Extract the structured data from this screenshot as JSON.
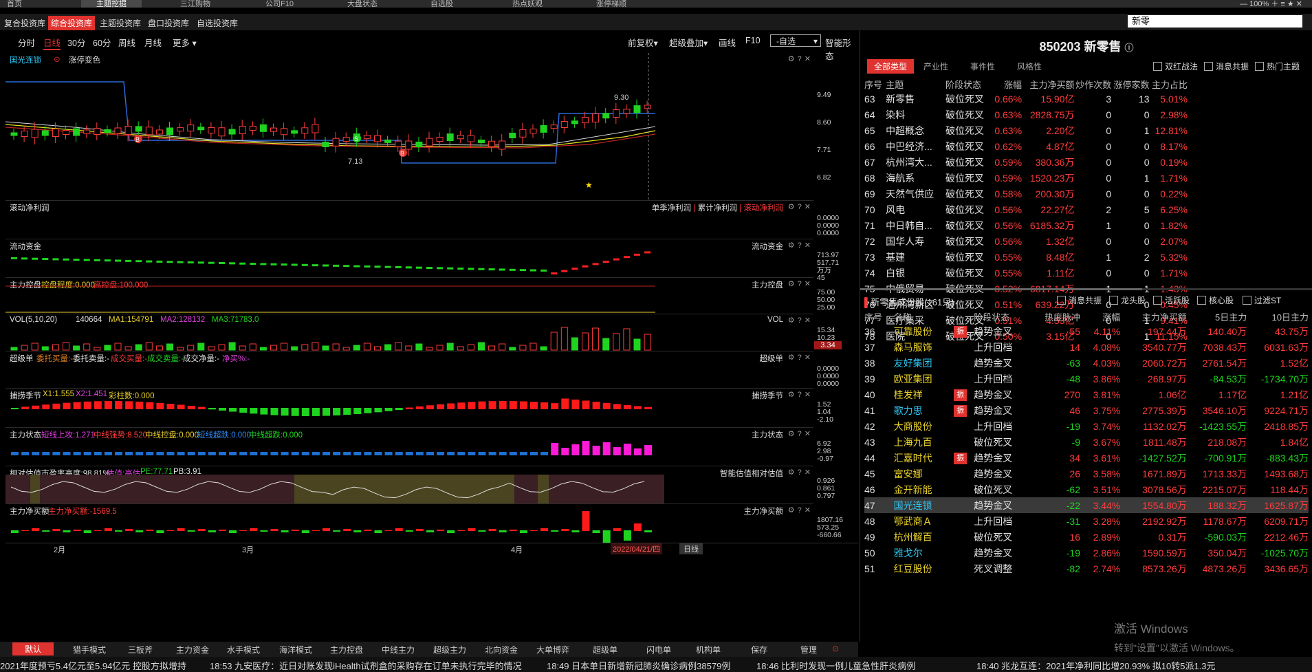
{
  "topnav": {
    "items": [
      "首页",
      "主题挖掘",
      "三江购物",
      "公司F10",
      "大盘状态",
      "自选股",
      "热点妖观",
      "涨停梯顺"
    ],
    "active_index": 1,
    "zoom": "100%"
  },
  "libraries": {
    "items": [
      "复合投资库",
      "综合投资库",
      "主题投资库",
      "盘口投资库",
      "自选投资库"
    ],
    "active_index": 1
  },
  "search": {
    "value": "新零"
  },
  "chart_toolbar": {
    "periods": [
      "分时",
      "日线",
      "30分",
      "60分",
      "周线",
      "月线",
      "更多 ▾"
    ],
    "active_index": 1,
    "right": [
      "前复权▾",
      "超级叠加▾",
      "画线",
      "F10"
    ],
    "self_select": "-自选",
    "smart": "智能形态"
  },
  "panels": {
    "main": {
      "name": "国光连锁",
      "limit": "涨停变色",
      "price_high_label": "9.30",
      "price_low_label": "7.13",
      "axis": [
        "9.49",
        "8.60",
        "7.71",
        "6.82"
      ]
    },
    "profit": {
      "title": "滚动净利润",
      "r1": "单季净利润",
      "r2": "累计净利润",
      "r3": "滚动净利润",
      "axis": [
        "0.0000",
        "0.0000",
        "0.0000"
      ]
    },
    "flow": {
      "title": "流动资金",
      "r": "流动资金",
      "axis": [
        "713.97",
        "517.71",
        "万万45"
      ]
    },
    "control": {
      "title": "主力控盘",
      "a": "控盘程度:0.000",
      "b": "高控盘:100.000",
      "r": "主力控盘",
      "axis": [
        "75.00",
        "50.00",
        "25.00"
      ]
    },
    "vol": {
      "title": "VOL(5,10,20)",
      "v": "140664",
      "ma1": "MA1:154791",
      "ma2": "MA2:128132",
      "ma3": "MA3:71783.0",
      "r": "VOL",
      "axis": [
        "15.34",
        "10.23"
      ],
      "tag": "3.34"
    },
    "super": {
      "title": "超级单",
      "a": "委托买量:-",
      "b": "委托卖量:-",
      "c": "成交买量:-",
      "d": "成交卖量:-",
      "e": "成交净量:-",
      "f": "净买%:-",
      "r": "超级单",
      "axis": [
        "0.0000",
        "0.0000",
        "0.0000"
      ]
    },
    "catch": {
      "title": "捕捞季节",
      "a": "X1:1.555",
      "b": "X2:1.451",
      "c": "彩柱数:0.000",
      "r": "捕捞季节",
      "axis": [
        "1.52",
        "1.04",
        "-2.10"
      ]
    },
    "state": {
      "title": "主力状态",
      "a": "短线上攻:1.271",
      "b": "中线强势:8.520",
      "c": "中线控盘:0.000",
      "d": "短线超跌:0.000",
      "e": "中线超跌:0.000",
      "r": "主力状态",
      "axis": [
        "6.92",
        "2.98",
        "-0.97"
      ]
    },
    "val": {
      "title": "相对估值",
      "a": "市盈率高度:98.81%",
      "b": "估值:高估",
      "c": "PE:77.71",
      "d": "PB:3.91",
      "r": "智能估值相对估值",
      "axis": [
        "0.926",
        "0.861",
        "0.797"
      ]
    },
    "net": {
      "title": "主力净买额",
      "a": "主力净买额:-1569.5",
      "r": "主力净买额",
      "axis": [
        "1807.16",
        "573.25",
        "-660.66"
      ]
    }
  },
  "xaxis": {
    "labels": [
      "2月",
      "3月",
      "4月"
    ],
    "date": "2022/04/21/四",
    "period": "日线"
  },
  "right": {
    "title": "850203 新零售",
    "tabs": [
      "全部类型",
      "产业性",
      "事件性",
      "风格性"
    ],
    "checks": [
      "双红战法",
      "消息共振",
      "热门主题"
    ],
    "headers": [
      "序号",
      "主题",
      "阶段状态",
      "涨幅",
      "主力净买额",
      "炒作次数",
      "涨停家数",
      "主力占比"
    ],
    "rows": [
      [
        "63",
        "新零售",
        "破位死叉",
        "0.66%",
        "15.90亿",
        "3",
        "13",
        "5.01%"
      ],
      [
        "64",
        "染料",
        "破位死叉",
        "0.63%",
        "2828.75万",
        "0",
        "0",
        "2.98%"
      ],
      [
        "65",
        "中超概念",
        "破位死叉",
        "0.63%",
        "2.20亿",
        "0",
        "1",
        "12.81%"
      ],
      [
        "66",
        "中巴经济...",
        "破位死叉",
        "0.62%",
        "4.87亿",
        "0",
        "0",
        "8.17%"
      ],
      [
        "67",
        "杭州湾大...",
        "破位死叉",
        "0.59%",
        "380.36万",
        "0",
        "0",
        "0.19%"
      ],
      [
        "68",
        "海航系",
        "破位死叉",
        "0.59%",
        "1520.23万",
        "0",
        "1",
        "1.71%"
      ],
      [
        "69",
        "天然气供应",
        "破位死叉",
        "0.58%",
        "200.30万",
        "0",
        "0",
        "0.22%"
      ],
      [
        "70",
        "风电",
        "破位死叉",
        "0.56%",
        "22.27亿",
        "2",
        "5",
        "6.25%"
      ],
      [
        "71",
        "中日韩自...",
        "破位死叉",
        "0.56%",
        "6185.32万",
        "1",
        "0",
        "1.82%"
      ],
      [
        "72",
        "国华人寿",
        "破位死叉",
        "0.56%",
        "1.32亿",
        "0",
        "0",
        "2.07%"
      ],
      [
        "73",
        "基建",
        "破位死叉",
        "0.55%",
        "8.48亿",
        "1",
        "2",
        "5.32%"
      ],
      [
        "74",
        "白银",
        "破位死叉",
        "0.55%",
        "1.11亿",
        "0",
        "0",
        "1.71%"
      ],
      [
        "75",
        "中俄贸易",
        "破位死叉",
        "0.52%",
        "6817.14万",
        "1",
        "1",
        "1.43%"
      ],
      [
        "76",
        "通州湾新区",
        "破位死叉",
        "0.51%",
        "639.22万",
        "0",
        "0",
        "0.45%"
      ],
      [
        "77",
        "医疗集采",
        "破位死叉",
        "0.51%",
        "4.53亿",
        "0",
        "1",
        "9.41%"
      ],
      [
        "78",
        "医院",
        "破位死叉",
        "0.50%",
        "3.15亿",
        "0",
        "1",
        "11.15%"
      ]
    ],
    "comp_title": "新零售成份股(161只)",
    "comp_checks": [
      "消息共振",
      "龙头股",
      "活跃股",
      "核心股",
      "过滤ST"
    ],
    "comp_headers": [
      "序号",
      "名称",
      "",
      "阶段状态",
      "热度脉冲",
      "涨幅",
      "主力净买额",
      "5日主力",
      "10日主力"
    ],
    "comp_rows": [
      [
        "36",
        "可靠股份",
        "振",
        "趋势金叉",
        "55",
        "4.11%",
        "197.44万",
        "140.40万",
        "43.75万"
      ],
      [
        "37",
        "森马服饰",
        "",
        "上升回档",
        "14",
        "4.08%",
        "3540.77万",
        "7038.43万",
        "6031.63万"
      ],
      [
        "38",
        "友好集团",
        "",
        "趋势金叉",
        "-63",
        "4.03%",
        "2060.72万",
        "2761.54万",
        "1.52亿"
      ],
      [
        "39",
        "欧亚集团",
        "",
        "上升回档",
        "-48",
        "3.86%",
        "268.97万",
        "-84.53万",
        "-1734.70万"
      ],
      [
        "40",
        "桂发祥",
        "振",
        "趋势金叉",
        "270",
        "3.81%",
        "1.06亿",
        "1.17亿",
        "1.21亿"
      ],
      [
        "41",
        "歌力思",
        "振",
        "趋势金叉",
        "46",
        "3.75%",
        "2775.39万",
        "3546.10万",
        "9224.71万"
      ],
      [
        "42",
        "大商股份",
        "",
        "上升回档",
        "-19",
        "3.74%",
        "1132.02万",
        "-1423.55万",
        "2418.85万"
      ],
      [
        "43",
        "上海九百",
        "",
        "破位死叉",
        "-9",
        "3.67%",
        "1811.48万",
        "218.08万",
        "1.84亿"
      ],
      [
        "44",
        "汇嘉时代",
        "振",
        "趋势金叉",
        "34",
        "3.61%",
        "-1427.52万",
        "-700.91万",
        "-883.43万"
      ],
      [
        "45",
        "富安娜",
        "",
        "趋势金叉",
        "26",
        "3.58%",
        "1671.89万",
        "1713.33万",
        "1493.68万"
      ],
      [
        "46",
        "金开新能",
        "",
        "破位死叉",
        "-62",
        "3.51%",
        "3078.56万",
        "2215.07万",
        "118.44万"
      ],
      [
        "47",
        "国光连锁",
        "",
        "趋势金叉",
        "-22",
        "3.44%",
        "1554.80万",
        "188.32万",
        "1625.87万"
      ],
      [
        "48",
        "鄂武商Ａ",
        "",
        "上升回档",
        "-31",
        "3.28%",
        "2192.92万",
        "1178.67万",
        "6209.71万"
      ],
      [
        "49",
        "杭州解百",
        "",
        "破位死叉",
        "16",
        "2.89%",
        "0.31万",
        "-590.03万",
        "2212.46万"
      ],
      [
        "50",
        "雅戈尔",
        "",
        "趋势金叉",
        "-19",
        "2.86%",
        "1590.59万",
        "350.04万",
        "-1025.70万"
      ],
      [
        "51",
        "红豆股份",
        "",
        "死叉调整",
        "-82",
        "2.74%",
        "8573.26万",
        "4873.26万",
        "3436.65万"
      ]
    ],
    "selected_row": 11
  },
  "bottom_tabs": {
    "items": [
      "默认",
      "猎手模式",
      "三板斧",
      "主力资金",
      "水手模式",
      "海洋模式",
      "主力控盘",
      "中线主力",
      "超级主力",
      "北向资金",
      "大单博弈",
      "超级单",
      "闪电单",
      "机构单",
      "保存",
      "管理"
    ],
    "active_index": 0
  },
  "ticker": [
    "2021年度预亏5.4亿元至5.94亿元 控股方拟增持",
    "18:53 九安医疗：近日对账发现iHealth试剂盒的采购存在订单未执行完毕的情况",
    "18:49 日本单日新增新冠肺炎确诊病例38579例",
    "18:46 比利时发现一例儿童急性肝炎病例",
    "18:40 兆龙互连：2021年净利同比增20.93% 拟10转5派1.3元"
  ],
  "watermark": {
    "line1": "激活 Windows",
    "line2": "转到\"设置\"以激活 Windows。"
  },
  "colors": {
    "accent": "#e0322e",
    "up": "#ff3b3b",
    "down": "#1fd41f"
  }
}
